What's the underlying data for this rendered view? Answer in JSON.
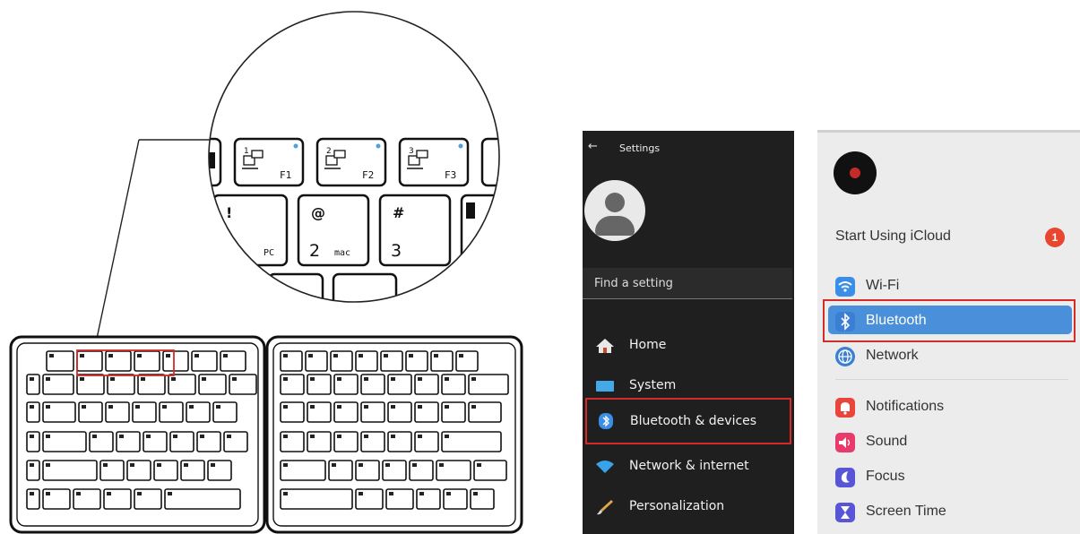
{
  "keyboard": {
    "zoom_keys": [
      {
        "num": "1",
        "label": "F1"
      },
      {
        "num": "2",
        "label": "F2"
      },
      {
        "num": "3",
        "label": "F3"
      }
    ],
    "zoom_row2": [
      {
        "top": "!",
        "sub": "PC"
      },
      {
        "top": "@",
        "main": "2",
        "sub": "mac"
      },
      {
        "top": "#",
        "main": "3"
      }
    ]
  },
  "windows": {
    "back": "←",
    "title": "Settings",
    "search_placeholder": "Find a setting",
    "nav": [
      {
        "label": "Home",
        "icon": "home-icon"
      },
      {
        "label": "System",
        "icon": "system-icon"
      },
      {
        "label": "Bluetooth & devices",
        "icon": "bluetooth-icon"
      },
      {
        "label": "Network & internet",
        "icon": "wifi-icon"
      },
      {
        "label": "Personalization",
        "icon": "brush-icon"
      }
    ],
    "highlight_color": "#d42b2b"
  },
  "mac": {
    "icloud": "Start Using iCloud",
    "badge": "1",
    "items": [
      {
        "label": "Wi-Fi",
        "icon": "wifi-icon",
        "color": "#3b8ee8"
      },
      {
        "label": "Bluetooth",
        "icon": "bluetooth-icon",
        "color": "#3b7fd4"
      },
      {
        "label": "Network",
        "icon": "globe-icon",
        "color": "#3b7fd4"
      },
      {
        "label": "Notifications",
        "icon": "bell-icon",
        "color": "#e8453c"
      },
      {
        "label": "Sound",
        "icon": "speaker-icon",
        "color": "#e83a6b"
      },
      {
        "label": "Focus",
        "icon": "moon-icon",
        "color": "#5856d6"
      },
      {
        "label": "Screen Time",
        "icon": "hourglass-icon",
        "color": "#5856d6"
      }
    ],
    "selected_color": "#4a8fd9"
  }
}
